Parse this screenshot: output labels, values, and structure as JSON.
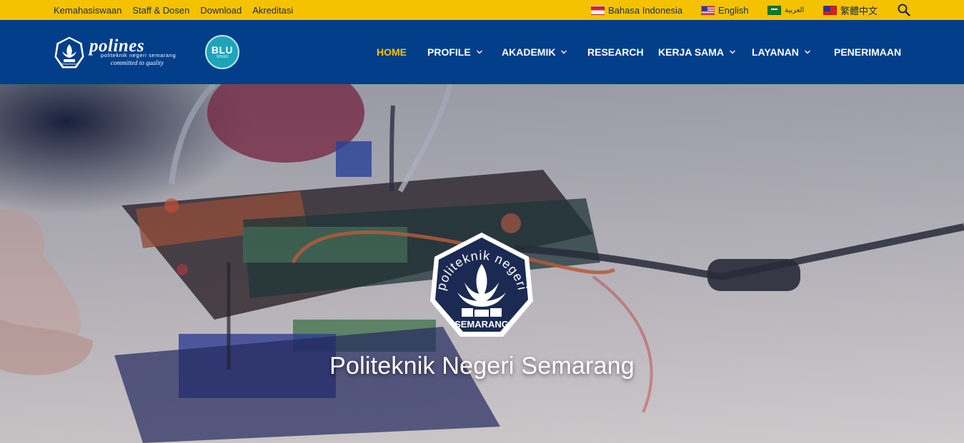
{
  "topbar": {
    "links": [
      "Kemahasiswaan",
      "Staff & Dosen",
      "Download",
      "Akreditasi"
    ],
    "languages": [
      {
        "label": "Bahasa Indonesia",
        "flag": "indonesia-flag-icon"
      },
      {
        "label": "English",
        "flag": "us-flag-icon"
      },
      {
        "label": "العربية",
        "flag": "saudi-flag-icon"
      },
      {
        "label": "繁體中文",
        "flag": "taiwan-flag-icon"
      }
    ],
    "search_icon": "search-icon",
    "bg_color": "#f5c200"
  },
  "navbar": {
    "logo": {
      "wordmark": "polines",
      "tagline": "politeknik negeri semarang",
      "motto": "committed to quality",
      "seal_text": "SEMARANG"
    },
    "blu_badge": {
      "text": "BLU",
      "sub": "SPEED"
    },
    "menu": [
      {
        "label": "HOME",
        "active": true,
        "dropdown": false
      },
      {
        "label": "PROFILE",
        "active": false,
        "dropdown": true
      },
      {
        "label": "AKADEMIK",
        "active": false,
        "dropdown": true
      },
      {
        "label": "RESEARCH",
        "active": false,
        "dropdown": false
      },
      {
        "label": "KERJA SAMA",
        "active": false,
        "dropdown": true
      },
      {
        "label": "LAYANAN",
        "active": false,
        "dropdown": true
      },
      {
        "label": "PENERIMAAN",
        "active": false,
        "dropdown": false
      }
    ],
    "bg_color": "#023e8a",
    "active_color": "#f5c200"
  },
  "hero": {
    "emblem_arc_text": "politeknik negeri",
    "emblem_bottom_text": "SEMARANG",
    "title": "Politeknik Negeri Semarang"
  }
}
